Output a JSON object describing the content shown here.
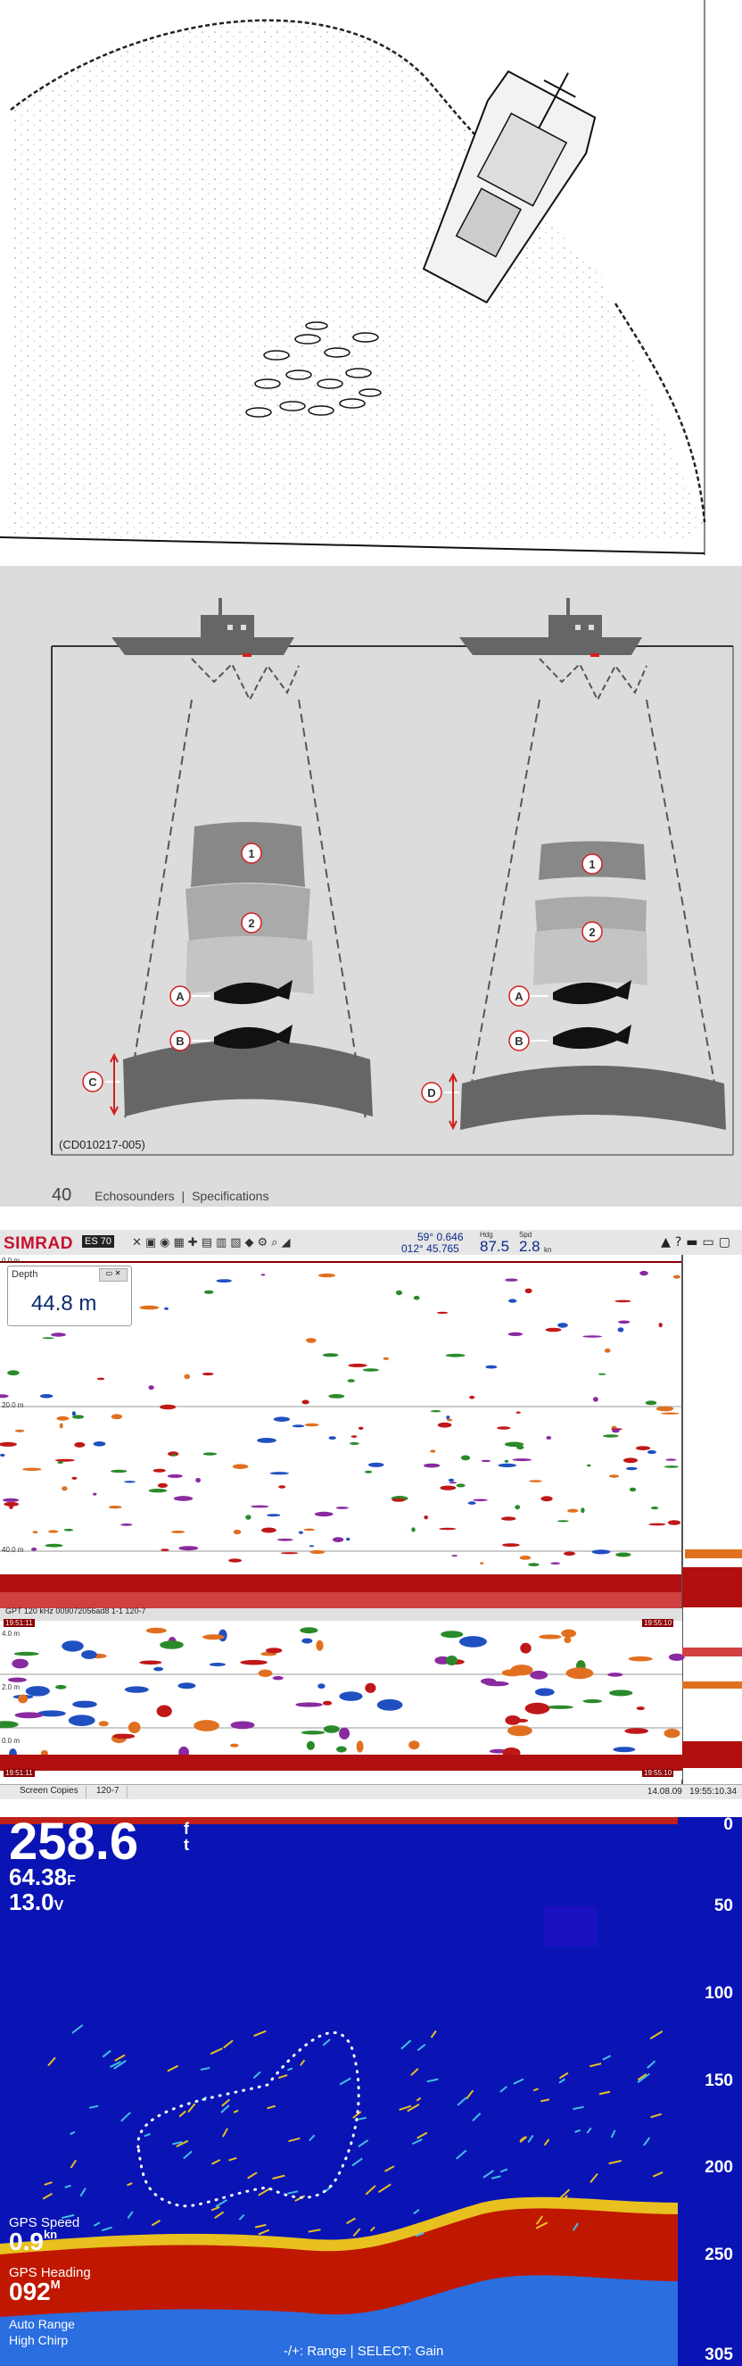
{
  "panel_diagram": {
    "markers": [
      "1",
      "2",
      "A",
      "B",
      "C",
      "D"
    ],
    "code": "(CD010217-005)",
    "page_number": "40",
    "section": "Echosounders",
    "separator": "|",
    "subsection": "Specifications"
  },
  "panel_simrad": {
    "brand": "SIMRAD",
    "brand_badge": "ES 70",
    "position_lat": "59° 0.646",
    "position_lon": "012° 45.765",
    "hdg_label": "Hdg",
    "heading": "87.5",
    "spd_label": "Spd",
    "speed": "2.8",
    "speed_unit": "kn",
    "depth_title": "Depth",
    "depth_value": "44.8 m",
    "scale_top": [
      "0.0 m",
      "20.0 m",
      "40.0 m"
    ],
    "scale_bottom": [
      "4.0 m",
      "2.0 m",
      "0.0 m"
    ],
    "channel_label": "GPT 120 kHz 009072056ad8 1-1 120-7",
    "times": [
      "19:51:11",
      "19:55:10",
      "19:51:11",
      "19:55:10"
    ],
    "tabs": [
      "Screen Copies",
      "120-7"
    ],
    "date": "14.08.09",
    "clock": "19:55:10.34"
  },
  "panel_sonar": {
    "depth": "258.6",
    "depth_unit_top": "f",
    "depth_unit_bottom": "t",
    "temp": "64.38",
    "temp_unit": "F",
    "voltage": "13.0",
    "voltage_unit": "V",
    "gps_speed_label": "GPS Speed",
    "gps_speed": "0.9",
    "gps_speed_unit": "kn",
    "gps_heading_label": "GPS Heading",
    "gps_heading": "092",
    "gps_heading_unit": "M",
    "auto_range": "Auto Range",
    "mode": "High Chirp",
    "hint": "-/+: Range | SELECT: Gain",
    "scale": [
      "0",
      "50",
      "100",
      "150",
      "200",
      "250",
      "305"
    ],
    "colors": {
      "water": "#0a14b4",
      "bottom": "#c01800",
      "target": "#e8c020"
    }
  }
}
